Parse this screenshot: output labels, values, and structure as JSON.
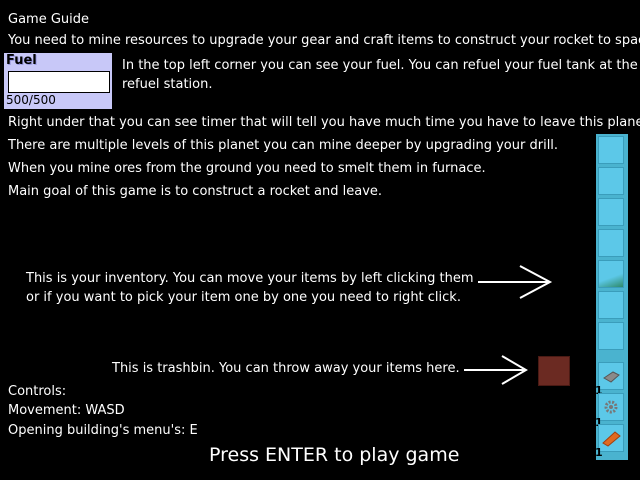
{
  "guide": {
    "title": "Game Guide",
    "line1": "You need to mine resources to upgrade your gear and craft items to construct your rocket to space",
    "fuel_text_1": "In the top left corner you can see your fuel. You can refuel your fuel tank at the",
    "fuel_text_2": "refuel station.",
    "timer_text": "Right under that you can see timer that will tell you have much time you have to leave this planet.",
    "levels_text": "There are multiple levels of this planet you can mine deeper by upgrading your drill.",
    "smelt_text": "When you mine ores from the ground you need to smelt them in furnace.",
    "goal_text": "Main goal of this game is to construct a rocket and leave.",
    "inventory_text_1": "This is your inventory. You can move your items by left clicking them",
    "inventory_text_2": "or if you want to pick your item one by one you need to right click.",
    "trash_text": "This is trashbin. You can throw away your items here.",
    "controls_title": "Controls:",
    "controls_movement": "Movement: WASD",
    "controls_building": "Opening building's menu's: E",
    "enter_prompt": "Press ENTER to play game"
  },
  "fuel": {
    "label": "Fuel",
    "value": "500/500",
    "fill_fraction": 1.0
  },
  "inventory": {
    "counts": [
      "1",
      "1",
      "1"
    ],
    "items": [
      "stone-icon",
      "gear-icon",
      "copper-bar-icon"
    ]
  },
  "colors": {
    "inventory": "#4ab3cf",
    "trash": "#6b2a22",
    "fuel_panel": "#c8c8f8"
  }
}
